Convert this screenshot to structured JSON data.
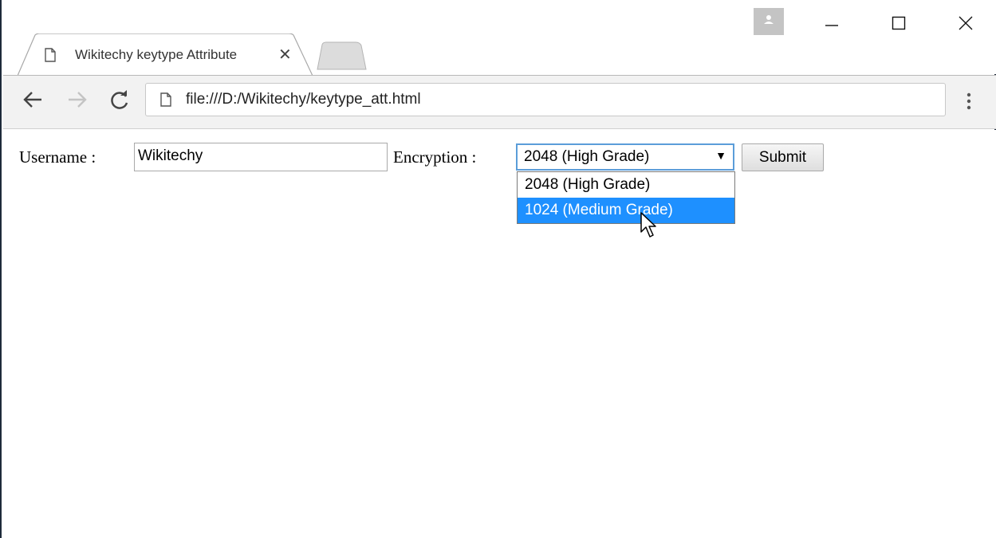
{
  "browser": {
    "tab": {
      "title": "Wikitechy keytype Attribute",
      "close_glyph": "✕"
    },
    "address": "file:///D:/Wikitechy/keytype_att.html"
  },
  "form": {
    "username_label": "Username :",
    "username_value": "Wikitechy",
    "encryption_label": "Encryption :",
    "select_value": "2048 (High Grade)",
    "select_arrow": "▼",
    "options": [
      "2048 (High Grade)",
      "1024 (Medium Grade)"
    ],
    "highlighted_option": "1024 (Medium Grade)",
    "submit_label": "Submit"
  },
  "colors": {
    "highlight": "#1e90ff",
    "focus_border": "#5b9dd9",
    "window_border": "#1e2a3a"
  }
}
